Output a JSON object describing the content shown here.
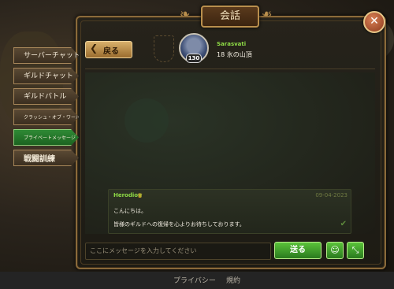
{
  "window": {
    "title": "会話",
    "close_symbol": "✕"
  },
  "tabs": [
    {
      "label": "サーバーチャット",
      "active": false
    },
    {
      "label": "ギルドチャット",
      "active": false
    },
    {
      "label": "ギルドバトル",
      "active": false
    },
    {
      "label": "クラッシュ・オブ・ワールド",
      "active": false
    },
    {
      "label": "プライベートメッセージ",
      "active": true
    },
    {
      "label": "戦闘訓練",
      "active": false
    }
  ],
  "header": {
    "back_label": "戻る",
    "back_icon": "chevron-left-icon",
    "user_name": "Sarasvati",
    "user_detail": "18 氷の山頂",
    "user_level": "130"
  },
  "messages": [
    {
      "sender": "Herodion",
      "sender_icon": "crown-icon",
      "date": "09-04-2023",
      "line1": "こんにちは。",
      "line2": "皆様のギルドへの復帰を心よりお待ちしております。",
      "status_icon": "checkmark-icon"
    }
  ],
  "composer": {
    "placeholder": "ここにメッセージを入力してください",
    "send_label": "送る",
    "emoji_icon": "smiley-icon",
    "expand_icon": "expand-icon"
  },
  "footer": {
    "privacy_label": "プライバシー",
    "terms_label": "規約"
  },
  "colors": {
    "accent_green": "#3a9a2a",
    "gold_border": "#b98f4d",
    "username_green": "#8edb46"
  }
}
